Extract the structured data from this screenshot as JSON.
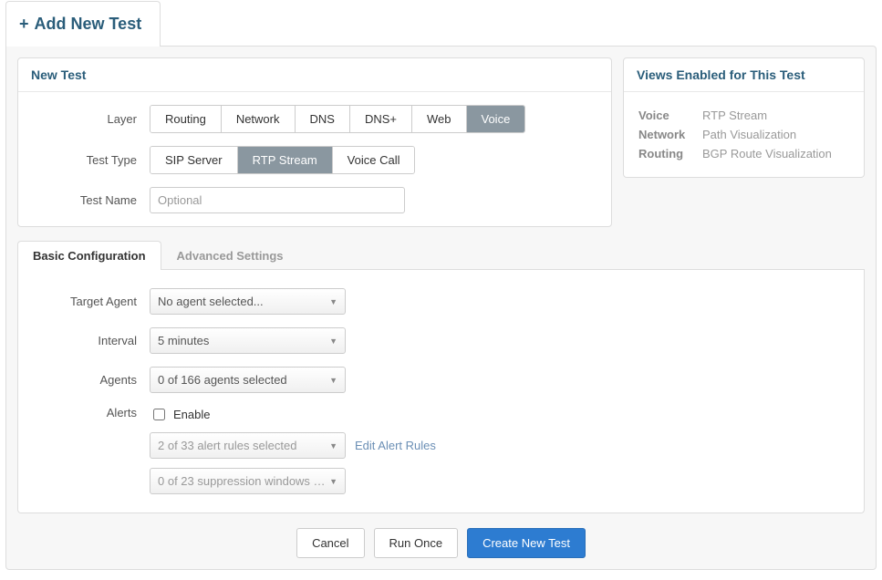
{
  "header": {
    "title": "Add New Test"
  },
  "new_test": {
    "heading": "New Test",
    "labels": {
      "layer": "Layer",
      "test_type": "Test Type",
      "test_name": "Test Name"
    },
    "layer_options": [
      "Routing",
      "Network",
      "DNS",
      "DNS+",
      "Web",
      "Voice"
    ],
    "layer_selected": "Voice",
    "test_type_options": [
      "SIP Server",
      "RTP Stream",
      "Voice Call"
    ],
    "test_type_selected": "RTP Stream",
    "test_name_placeholder": "Optional"
  },
  "views": {
    "heading": "Views Enabled for This Test",
    "rows": [
      {
        "label": "Voice",
        "value": "RTP Stream"
      },
      {
        "label": "Network",
        "value": "Path Visualization"
      },
      {
        "label": "Routing",
        "value": "BGP Route Visualization"
      }
    ]
  },
  "tabs": {
    "basic": "Basic Configuration",
    "advanced": "Advanced Settings",
    "active": "basic"
  },
  "config": {
    "labels": {
      "target_agent": "Target Agent",
      "interval": "Interval",
      "agents": "Agents",
      "alerts": "Alerts"
    },
    "target_agent_value": "No agent selected...",
    "interval_value": "5 minutes",
    "agents_value": "0 of 166 agents selected",
    "alerts_enable_label": "Enable",
    "alerts_enable_checked": false,
    "alert_rules_value": "2 of 33 alert rules selected",
    "edit_alert_rules_label": "Edit Alert Rules",
    "suppression_value": "0 of 23 suppression windows …"
  },
  "footer": {
    "cancel": "Cancel",
    "run_once": "Run Once",
    "create": "Create New Test"
  }
}
